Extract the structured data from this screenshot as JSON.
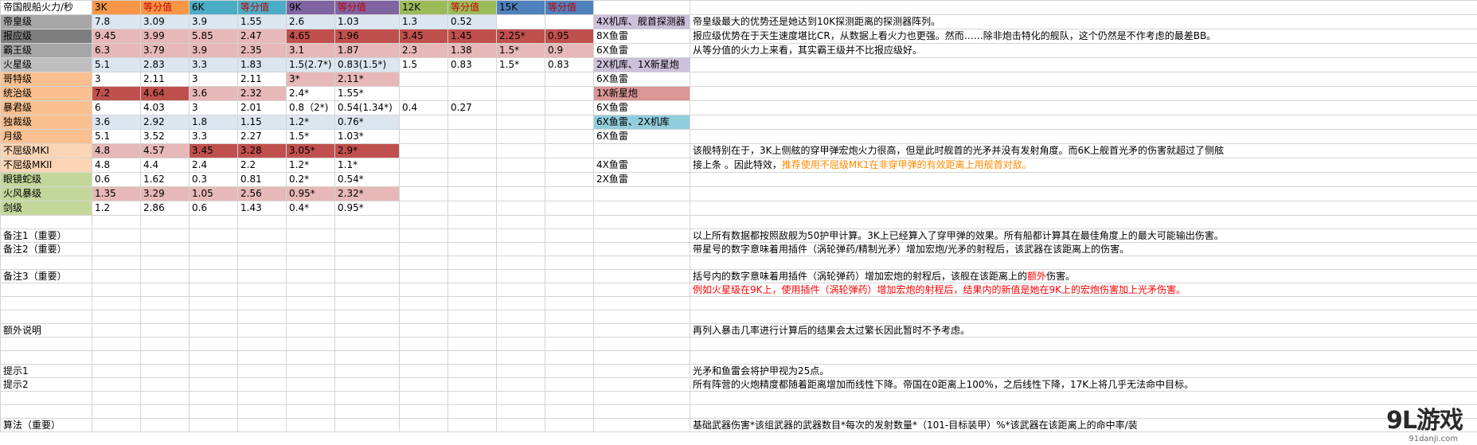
{
  "colors": {
    "header_label": "#ffffff",
    "dist3k": "#f79646",
    "dist6k": "#4bacc6",
    "dist9k": "#8064a2",
    "dist12k": "#9bbb59",
    "dist15k": "#4f81bd",
    "row_gray_dark": "#7f7f7f",
    "row_gray_mid": "#a6a6a6",
    "row_gray_light": "#bfbfbf",
    "row_peach": "#fac090",
    "row_peach_light": "#fcd5b4",
    "row_green": "#c4d79b",
    "cell_red_dark": "#c0504d",
    "cell_red_light": "#e6b8b7",
    "cell_blue_light": "#dce6f1",
    "weapon_purple": "#ccc0da",
    "weapon_red": "#da9694",
    "weapon_cyan": "#92cddc",
    "text_red": "#ff0000",
    "text_orange": "#ff8a00"
  },
  "header": {
    "title": "帝国舰船火力/秒",
    "cols": [
      "3K",
      "等分值",
      "6K",
      "等分值",
      "9K",
      "等分值",
      "12K",
      "等分值",
      "15K",
      "等分值"
    ]
  },
  "ships": [
    {
      "name": "帝皇级",
      "v": [
        "7.8",
        "3.09",
        "3.9",
        "1.55",
        "2.6",
        "1.03",
        "1.3",
        "0.52",
        "",
        ""
      ],
      "weapon": "4X机库、舰首探测器",
      "note": "帝皇级最大的优势还是她达到10K探测距离的探测器阵列。"
    },
    {
      "name": "报应级",
      "v": [
        "9.45",
        "3.99",
        "5.85",
        "2.47",
        "4.65",
        "1.96",
        "3.45",
        "1.45",
        "2.25*",
        "0.95"
      ],
      "weapon": "8X鱼雷",
      "note": "报应级优势在于天生速度堪比CR，从数据上看火力也更强。然而……除非炮击特化的舰队，这个仍然是不作考虑的最差BB。"
    },
    {
      "name": "霸王级",
      "v": [
        "6.3",
        "3.79",
        "3.9",
        "2.35",
        "3.1",
        "1.87",
        "2.3",
        "1.38",
        "1.5*",
        "0.9"
      ],
      "weapon": "6X鱼雷",
      "note": "从等分值的火力上来看，其实霸王级并不比报应级好。"
    },
    {
      "name": "火星级",
      "v": [
        "5.1",
        "2.83",
        "3.3",
        "1.83",
        "1.5(2.7*)",
        "0.83(1.5*)",
        "1.5",
        "0.83",
        "1.5*",
        "0.83"
      ],
      "weapon": "2X机库、1X新星炮",
      "note": ""
    },
    {
      "name": "哥特级",
      "v": [
        "3",
        "2.11",
        "3",
        "2.11",
        "3*",
        "2.11*",
        "",
        "",
        "",
        ""
      ],
      "weapon": "6X鱼雷",
      "note": ""
    },
    {
      "name": "统治级",
      "v": [
        "7.2",
        "4.64",
        "3.6",
        "2.32",
        "2.4*",
        "1.55*",
        "",
        "",
        "",
        ""
      ],
      "weapon": "1X新星炮",
      "note": ""
    },
    {
      "name": "暴君级",
      "v": [
        "6",
        "4.03",
        "3",
        "2.01",
        "0.8（2*)",
        "0.54(1.34*)",
        "0.4",
        "0.27",
        "",
        ""
      ],
      "weapon": "6X鱼雷",
      "note": ""
    },
    {
      "name": "独裁级",
      "v": [
        "3.6",
        "2.92",
        "1.8",
        "1.15",
        "1.2*",
        "0.76*",
        "",
        "",
        "",
        ""
      ],
      "weapon": "6X鱼雷、2X机库",
      "note": ""
    },
    {
      "name": "月级",
      "v": [
        "5.1",
        "3.52",
        "3.3",
        "2.27",
        "1.5*",
        "1.03*",
        "",
        "",
        "",
        ""
      ],
      "weapon": "6X鱼雷",
      "note": ""
    },
    {
      "name": "不屈级MKI",
      "v": [
        "4.8",
        "4.57",
        "3.45",
        "3.28",
        "3.05*",
        "2.9*",
        "",
        "",
        "",
        ""
      ],
      "weapon": "",
      "note": "该舰特别在于，3K上侧舷的穿甲弹宏炮火力很高，但是此时舰首的光矛并没有发射角度。而6K上舰首光矛的伤害就超过了侧舷"
    },
    {
      "name": "不屈级MKII",
      "v": [
        "4.8",
        "4.4",
        "2.4",
        "2.2",
        "1.2*",
        "1.1*",
        "",
        "",
        "",
        ""
      ],
      "weapon": "4X鱼雷",
      "note": "接上条 。因此特效，",
      "note_orange": "推荐使用不屈级MK1在非穿甲弹的有效距离上用舰首对敌。"
    },
    {
      "name": "眼镜蛇级",
      "v": [
        "0.6",
        "1.62",
        "0.3",
        "0.81",
        "0.2*",
        "0.54*",
        "",
        "",
        "",
        ""
      ],
      "weapon": "2X鱼雷",
      "note": ""
    },
    {
      "name": "火风暴级",
      "v": [
        "1.35",
        "3.29",
        "1.05",
        "2.56",
        "0.95*",
        "2.32*",
        "",
        "",
        "",
        ""
      ],
      "weapon": "",
      "note": ""
    },
    {
      "name": "剑级",
      "v": [
        "1.2",
        "2.86",
        "0.6",
        "1.43",
        "0.4*",
        "0.95*",
        "",
        "",
        "",
        ""
      ],
      "weapon": "",
      "note": ""
    }
  ],
  "remarks": {
    "r1_label": "备注1（重要）",
    "r1_text": "以上所有数据都按照敌舰为50护甲计算。3K上已经算入了穿甲弹的效果。所有船都计算其在最佳角度上的最大可能输出伤害。",
    "r2_label": "备注2（重要）",
    "r2_text": "带星号的数字意味着用插件（涡轮弹药/精制光矛）增加宏炮/光矛的射程后，该武器在该距离上的伤害。",
    "r3_label": "备注3（重要）",
    "r3_text_a": "括号内的数字意味着用插件（涡轮弹药）增加宏炮的射程后，该舰在该距离上的",
    "r3_text_red": "额外",
    "r3_text_b": "伤害。",
    "r3_example": "例如火星级在9K上，使用插件（涡轮弹药）增加宏炮的射程后，结果内的新值是她在9K上的宏炮伤害加上光矛伤害。",
    "extra_label": "额外说明",
    "extra_text": "再列入暴击几率进行计算后的结果会太过繁长因此暂时不予考虑。",
    "tip1_label": "提示1",
    "tip1_text": "光矛和鱼雷会将护甲视为25点。",
    "tip2_label": "提示2",
    "tip2_text": "所有阵营的火炮精度都随着距离增加而线性下降。帝国在0距离上100%，之后线性下降，17K上将几乎无法命中目标。",
    "algo_label": "算法（重要）",
    "algo_text": "基础武器伤害*该组武器的武器数目*每次的发射数量*（101-目标装甲）%*该武器在该距离上的命中率/装"
  },
  "watermark": {
    "logo": "9L游戏",
    "sub": "91danji.com"
  }
}
